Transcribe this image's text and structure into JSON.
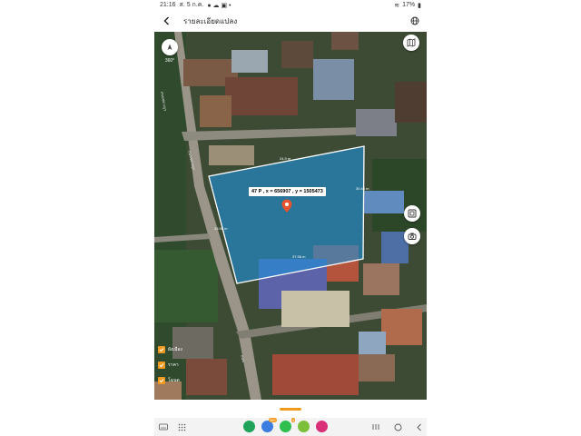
{
  "status_bar": {
    "time": "21:16",
    "date": "ส. 5 ก.ค.",
    "battery": "17%"
  },
  "app_bar": {
    "title": "รายละเอียดแปลง"
  },
  "map": {
    "parcel_info": "47 P , x = 656907 , y = 1505473",
    "edge_labels": [
      "24.9 m",
      "30.45 m",
      "43.98 m",
      "37.96 m"
    ],
    "compass_label": "360°",
    "road_label_1": "ถนนชยางกูร",
    "road_label_2": "ถนนชยางกูร",
    "road_label_3": "ถนน"
  },
  "layers": [
    {
      "label": "ผังเมือง"
    },
    {
      "label": "ราคา"
    },
    {
      "label": "โฉนด"
    }
  ],
  "dock": {
    "badge_1": "99+",
    "badge_2": "4"
  },
  "colors": {
    "parcel_fill": "#1e8fd8",
    "accent": "#f29a1f",
    "pin": "#e8542f"
  }
}
